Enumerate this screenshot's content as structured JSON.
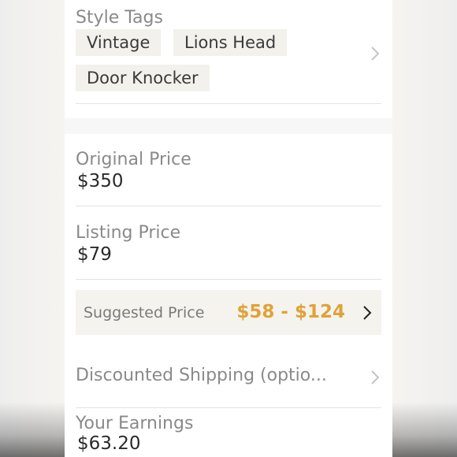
{
  "style_tags": {
    "label": "Style Tags",
    "tags": [
      "Vintage",
      "Lions Head",
      "Door Knocker"
    ],
    "chevron_icon": "chevron-right-icon"
  },
  "original_price": {
    "label": "Original Price",
    "value": "$350"
  },
  "listing_price": {
    "label": "Listing Price",
    "value": "$79"
  },
  "suggested_price": {
    "label": "Suggested Price",
    "range": "$58 - $124",
    "accent_color": "#e0a238",
    "chevron_icon": "chevron-right-icon"
  },
  "discounted_shipping": {
    "label": "Discounted Shipping (optio...",
    "chevron_icon": "chevron-right-icon"
  },
  "your_earnings": {
    "label": "Your Earnings",
    "value": "$63.20"
  }
}
